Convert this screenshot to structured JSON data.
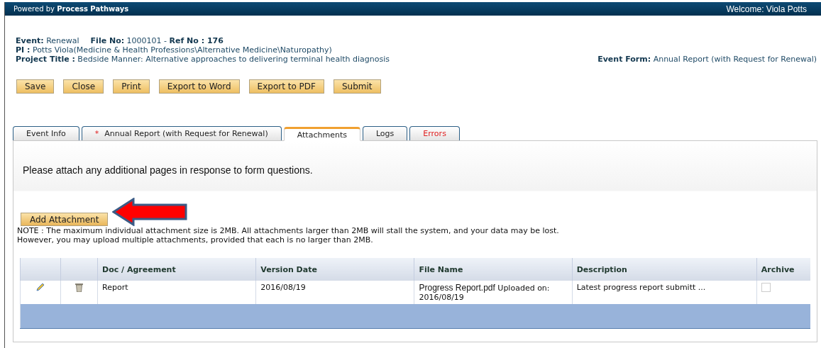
{
  "header": {
    "powered_by": "Powered by **Process Pathways**",
    "welcome": "Welcome: Viola Potts"
  },
  "info": {
    "line_1": [
      "**Event:** Renewal",
      "**File No:** 1000101 - **Ref No : 176**"
    ],
    "pi": "**PI :** Potts Viola(Medicine & Health Professions\\Alternative Medicine\\Naturopathy)",
    "project_title": "**Project Title :** Bedside Manner: Alternative approaches to delivering terminal health diagnosis",
    "event_form": "**Event Form:** Annual Report (with Request for Renewal)"
  },
  "buttons": [
    "Save",
    "Close",
    "Print",
    "Export to Word",
    "Export to PDF",
    "Submit"
  ],
  "tabs": [
    {
      "label": "Event Info",
      "selected": false,
      "alert": false
    },
    {
      "label": "Annual Report (with Request for Renewal)",
      "marker": "*",
      "selected": false,
      "alert": false
    },
    {
      "label": "Attachments",
      "selected": true,
      "alert": false
    },
    {
      "label": "Logs",
      "selected": false,
      "alert": false
    },
    {
      "label": "Errors",
      "selected": false,
      "alert": true
    }
  ],
  "panel": {
    "instruction": "Please attach any additional pages in response to form questions.",
    "add_button": "Add Attachment",
    "notes": [
      "NOTE : The maximum individual attachment size is 2MB. All attachments larger than 2MB will stall the system, and your data may be lost.",
      "However, you may upload multiple attachments, provided that each is no larger than 2MB."
    ],
    "table": {
      "columns": [
        "Doc / Agreement",
        "Version Date",
        "File Name",
        "Description",
        "Archive"
      ],
      "rows": [
        {
          "doc": "Report",
          "version_date": "2016/08/19",
          "file_name": "Progress Report.pdf",
          "uploaded": "Uploaded on: 2016/08/19",
          "description": "Latest progress report submitt ...",
          "archived": false
        }
      ]
    }
  }
}
